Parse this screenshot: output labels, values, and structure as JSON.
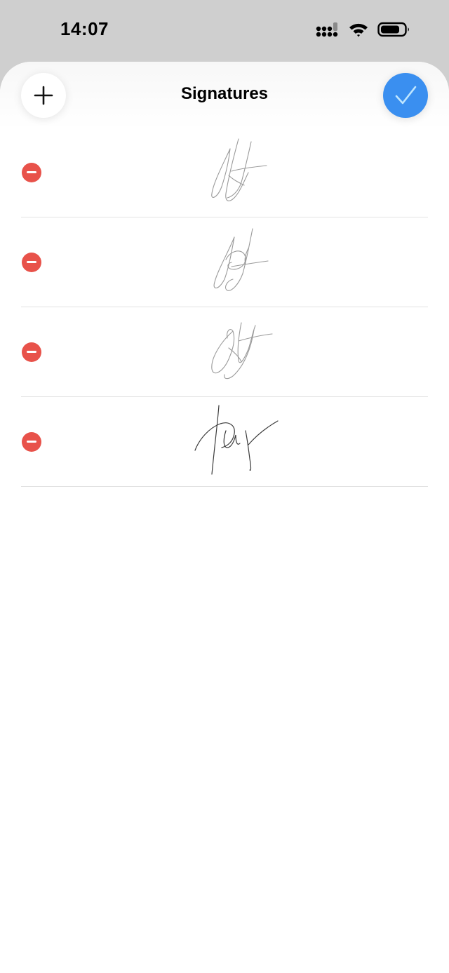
{
  "status_bar": {
    "time": "14:07"
  },
  "nav": {
    "title": "Signatures",
    "add_icon": "plus-icon",
    "done_icon": "checkmark-icon"
  },
  "colors": {
    "accent": "#3a8ff0",
    "delete": "#e8524a",
    "divider": "#e2e2e2"
  },
  "signatures": [
    {
      "style": "light",
      "stroke": "#9a9a9a"
    },
    {
      "style": "light",
      "stroke": "#9a9a9a"
    },
    {
      "style": "light",
      "stroke": "#9a9a9a"
    },
    {
      "style": "dark",
      "stroke": "#3a3a3a"
    }
  ]
}
